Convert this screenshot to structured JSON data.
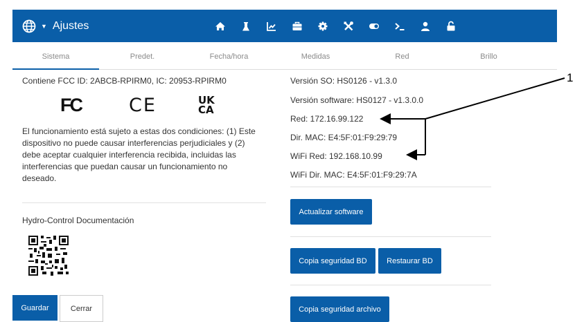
{
  "header": {
    "title": "Ajustes",
    "icons": [
      "globe-icon",
      "home-icon",
      "flask-icon",
      "chart-icon",
      "toolbox-icon",
      "gear-icon",
      "tools-icon",
      "toggle-icon",
      "terminal-icon",
      "user-icon",
      "unlock-icon"
    ]
  },
  "tabs": [
    "Sistema",
    "Predet.",
    "Fecha/hora",
    "Medidas",
    "Red",
    "Brillo"
  ],
  "left": {
    "fcc_line": "Contiene FCC ID: 2ABCB-RPIRM0, IC: 20953-RPIRM0",
    "logos": {
      "fc": "FC",
      "ce": "CE",
      "ukca_top": "UK",
      "ukca_bottom": "CA"
    },
    "conditions_1": "El funcionamiento está sujeto a estas dos condiciones: (1) Este",
    "conditions_2": "dispositivo no puede causar interferencias perjudiciales y (2)",
    "conditions_3": "debe aceptar cualquier interferencia recibida, incluidas las",
    "conditions_4": "interferencias que puedan causar un funcionamiento no",
    "conditions_5": "deseado.",
    "doc_title": "Hydro-Control Documentación"
  },
  "right": {
    "so_version": "Versión SO: HS0126 - v1.3.0",
    "sw_version": "Versión software: HS0127 - v1.3.0.0",
    "ip": "Red: 172.16.99.122",
    "mac": "Dir. MAC: E4:5F:01:F9:29:79",
    "wifi_ip": "WiFi Red: 192.168.10.99",
    "wifi_mac": "WiFi Dir. MAC: E4:5F:01:F9:29:7A"
  },
  "buttons": {
    "update": "Actualizar software",
    "backup_db": "Copia seguridad BD",
    "restore_db": "Restaurar BD",
    "backup_file": "Copia seguridad archivo",
    "save": "Guardar",
    "close": "Cerrar"
  },
  "annotation": {
    "number": "1"
  },
  "colors": {
    "primary": "#0a5ea8",
    "tab_text": "#8a8a8a",
    "text": "#333333"
  }
}
